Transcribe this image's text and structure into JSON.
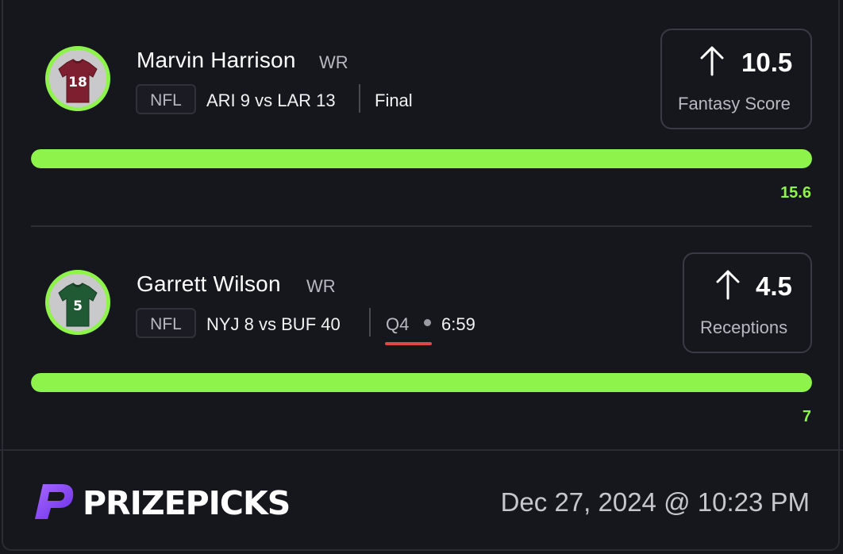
{
  "picks": [
    {
      "player_name": "Marvin Harrison",
      "position": "WR",
      "jersey_number": "18",
      "jersey_color": "#7d1f2e",
      "league": "NFL",
      "matchup": "ARI 9 vs LAR 13",
      "status": "Final",
      "direction": "up-arrow-icon",
      "line_value": "10.5",
      "stat_label": "Fantasy Score",
      "actual_value": "15.6",
      "progress": 1.0
    },
    {
      "player_name": "Garrett Wilson",
      "position": "WR",
      "jersey_number": "5",
      "jersey_color": "#1f5a35",
      "league": "NFL",
      "matchup": "NYJ 8 vs BUF 40",
      "quarter": "Q4",
      "clock": "6:59",
      "direction": "up-arrow-icon",
      "line_value": "4.5",
      "stat_label": "Receptions",
      "actual_value": "7",
      "progress": 1.0
    }
  ],
  "footer": {
    "brand": "PRIZEPICKS",
    "timestamp": "Dec 27, 2024 @ 10:23 PM"
  },
  "colors": {
    "accent_green": "#8ef34a",
    "live_red": "#e04848",
    "background": "#16161d",
    "brand_purple": "#7b3ff2"
  }
}
